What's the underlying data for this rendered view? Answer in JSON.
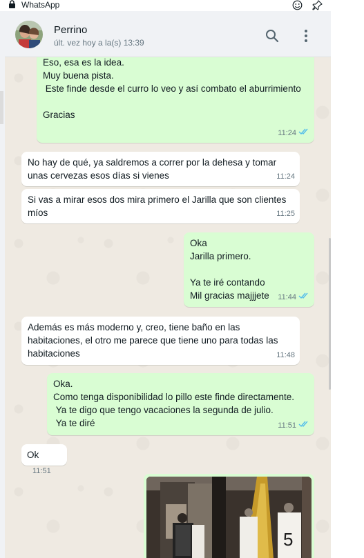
{
  "window": {
    "app_name": "WhatsApp",
    "icons": [
      "lock-icon",
      "emoji-icon",
      "pin-icon"
    ]
  },
  "header": {
    "contact_name": "Perrino",
    "status": "últ. vez hoy a la(s) 13:39",
    "icons": [
      "search-icon",
      "menu-icon"
    ]
  },
  "colors": {
    "incoming_bubble": "#ffffff",
    "outgoing_bubble": "#d9fdd3",
    "read_ticks": "#53bdeb",
    "chat_background": "#efeae2"
  },
  "messages": [
    {
      "direction": "out",
      "text": "Eso, esa es la idea.\nMuy buena pista.\n Este finde desde el curro lo veo y así combato el aburrimiento\n\nGracias",
      "time": "11:24",
      "read": true
    },
    {
      "direction": "in",
      "text": "No hay de qué, ya saldremos a correr por la dehesa y tomar unas cervezas esos días si vienes",
      "time": "11:24"
    },
    {
      "direction": "in",
      "text": "Si vas a mirar esos dos mira primero el Jarilla que son clientes míos",
      "time": "11:25"
    },
    {
      "direction": "out",
      "text": "Oka\nJarilla primero.\n\nYa te iré contando\nMil gracias majjjete",
      "time": "11:44",
      "read": true
    },
    {
      "direction": "in",
      "text": "Además es más moderno y, creo, tiene baño en las habitaciones, el otro me parece que tiene uno para todas las habitaciones",
      "time": "11:48"
    },
    {
      "direction": "out",
      "text": "Oka.\nComo tenga disponibilidad lo pillo este finde directamente.\n Ya te digo que tengo vacaciones la segunda de julio.\n Ya te diré",
      "time": "11:51",
      "read": true
    },
    {
      "direction": "in",
      "text": "Ok",
      "time": "11:51"
    },
    {
      "direction": "out",
      "type": "image",
      "image": "photo-of-store-with-jerseys"
    }
  ]
}
